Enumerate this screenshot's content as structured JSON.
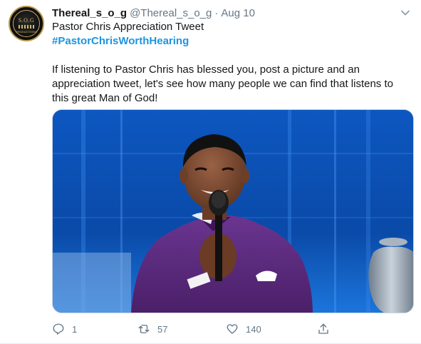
{
  "tweet": {
    "author_name": "Thereal_s_o_g",
    "author_handle": "@Thereal_s_o_g",
    "separator": "·",
    "date": "Aug 10",
    "line1": "Pastor Chris Appreciation Tweet",
    "hashtag": "#PastorChrisWorthHearing",
    "body": "If listening to Pastor Chris has blessed you, post a picture and an appreciation tweet, let's see how many people we can find that listens to this great Man of God!"
  },
  "avatar": {
    "logo_text": "S.O.G",
    "logo_sub": "PRODUCTIONS"
  },
  "actions": {
    "reply_count": "1",
    "retweet_count": "57",
    "like_count": "140"
  },
  "icons": {
    "menu": "chevron-down-icon",
    "reply": "reply-icon",
    "retweet": "retweet-icon",
    "like": "heart-icon",
    "share": "share-icon"
  },
  "colors": {
    "hashtag": "#1b95e0",
    "secondary_text": "#657786",
    "stage_blue": "#0b4fb3",
    "suit_purple": "#5a2a7a"
  }
}
